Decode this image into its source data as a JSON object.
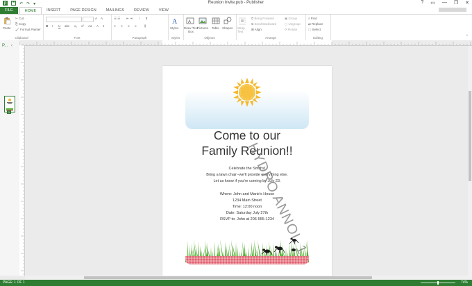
{
  "window": {
    "title": "Reunion Invite.pub - Publisher",
    "controls": [
      "?",
      "▭",
      "—",
      "❐",
      "✕"
    ]
  },
  "ribbon": {
    "tabs": [
      "FILE",
      "HOME",
      "INSERT",
      "PAGE DESIGN",
      "MAILINGS",
      "REVIEW",
      "VIEW"
    ],
    "active_tab": "HOME",
    "clipboard": {
      "label": "Clipboard",
      "paste": "Paste",
      "cut": "Cut",
      "copy": "Copy",
      "format_painter": "Format Painter"
    },
    "font": {
      "label": "Font"
    },
    "paragraph": {
      "label": "Paragraph"
    },
    "styles": {
      "label": "Styles",
      "styles_button": "Styles"
    },
    "objects": {
      "label": "Objects",
      "draw_text_box": "Draw Text Box",
      "pictures": "Pictures",
      "table": "Table",
      "shapes": "Shapes"
    },
    "arrange": {
      "label": "Arrange",
      "wrap_text": "Wrap Text",
      "bring_forward": "Bring Forward",
      "send_backward": "Send Backward",
      "align": "Align",
      "group": "Group",
      "ungroup": "Ungroup",
      "rotate": "Rotate"
    },
    "editing": {
      "label": "Editing",
      "find": "Find",
      "replace": "Replace",
      "select": "Select"
    }
  },
  "pages_pane": {
    "label": "P...",
    "page_number": "1"
  },
  "document": {
    "headline_line1": "Come to our",
    "headline_line2": "Family Reunion!!",
    "body": [
      "Celebrate the Smiths!",
      "Bring a lawn chair--we'll provide everything else.",
      "Let us know if you're coming by July 23."
    ],
    "details": [
      "Where: John and Marie's House",
      "1234 Main Street",
      "Time: 12:00 noon",
      "Date: Saturday July 27th",
      "RSVP to: John at 206-555-1234"
    ],
    "watermark": "HYDRO ANNOL 1"
  },
  "status": {
    "page": "PAGE: 1 OF 1",
    "zoom": "74%"
  },
  "colors": {
    "accent": "#2e7d32",
    "sky": "#cfe7f5",
    "sun": "#f5b82e",
    "blanket": "#e0606e",
    "grass": "#5fb83a"
  }
}
